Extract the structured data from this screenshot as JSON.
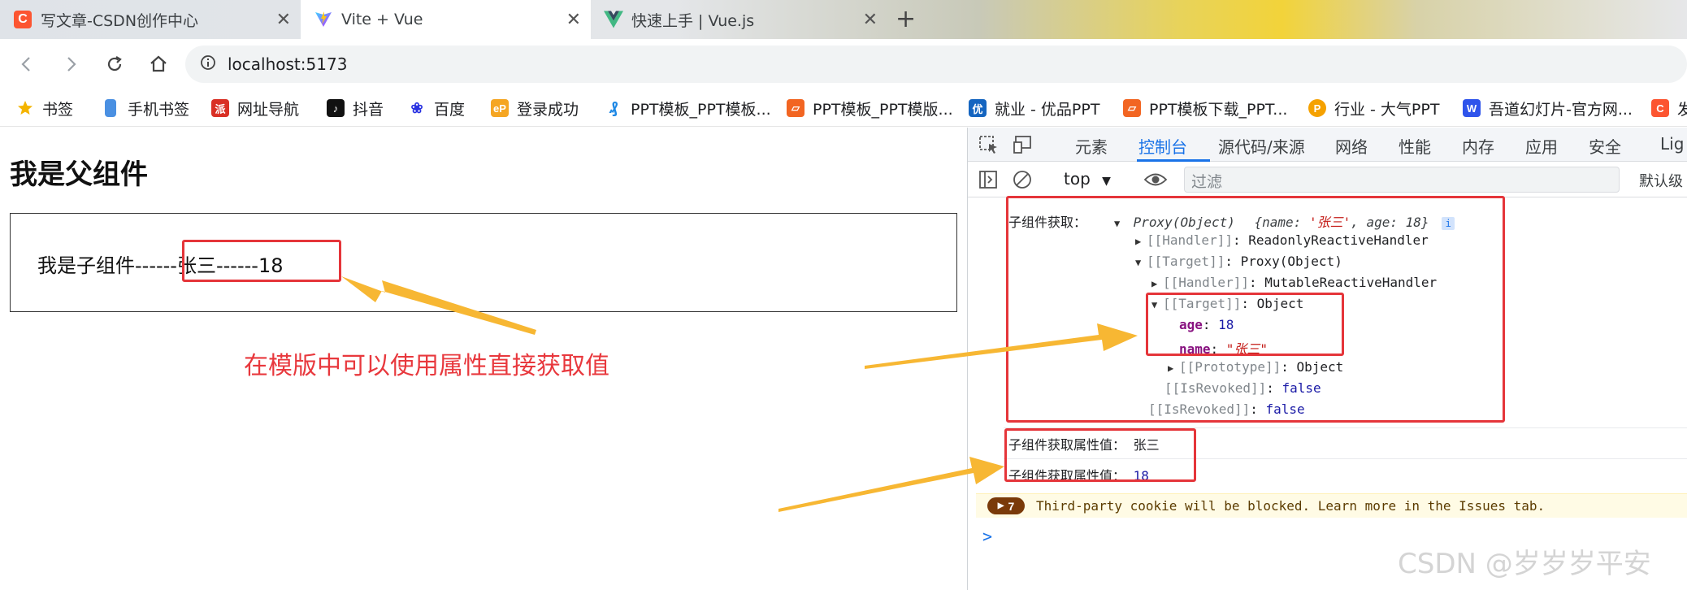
{
  "browser": {
    "tabs": [
      {
        "title": "写文章-CSDN创作中心",
        "favicon": "csdn-icon"
      },
      {
        "title": "Vite + Vue",
        "favicon": "vite-icon"
      },
      {
        "title": "快速上手 | Vue.js",
        "favicon": "vue-icon"
      }
    ],
    "new_tab_symbol": "+",
    "close_symbol": "✕",
    "url": "localhost:5173"
  },
  "bookmarks": [
    {
      "label": "书签",
      "icon": "star-icon",
      "color": "#f4b400"
    },
    {
      "label": "手机书签",
      "icon": "phone-icon",
      "color": "#4a90e2"
    },
    {
      "label": "网址导航",
      "icon": "nav-icon",
      "color": "#d93025"
    },
    {
      "label": "抖音",
      "icon": "douyin-icon",
      "color": "#111111"
    },
    {
      "label": "百度",
      "icon": "baidu-icon",
      "color": "#2932e1"
    },
    {
      "label": "登录成功",
      "icon": "ep-icon",
      "color": "#f5a623"
    },
    {
      "label": "PPT模板_PPT模板...",
      "icon": "ppt-icon",
      "color": "#1e88e5"
    },
    {
      "label": "PPT模板_PPT模版...",
      "icon": "ppt-orange-icon",
      "color": "#f26522"
    },
    {
      "label": "就业 - 优品PPT",
      "icon": "youpin-icon",
      "color": "#1565c0"
    },
    {
      "label": "PPT模板下载_PPT...",
      "icon": "ppt-orange2-icon",
      "color": "#f26522"
    },
    {
      "label": "行业 - 大气PPT",
      "icon": "daqi-icon",
      "color": "#f5a100"
    },
    {
      "label": "吾道幻灯片-官方网...",
      "icon": "wudao-icon",
      "color": "#2f54eb"
    },
    {
      "label": "发",
      "icon": "csdn-icon",
      "color": "#fc5531"
    }
  ],
  "page": {
    "parent_title": "我是父组件",
    "child_prefix": "我是子组件------",
    "child_name": "张三",
    "child_sep": "------",
    "child_age": "18",
    "annotation": "在模版中可以使用属性直接获取值"
  },
  "devtools": {
    "tabs": [
      "元素",
      "控制台",
      "源代码/来源",
      "网络",
      "性能",
      "内存",
      "应用",
      "安全",
      "Lig"
    ],
    "active_tab": "控制台",
    "context": "top",
    "filter_placeholder": "过滤",
    "level": "默认级",
    "console": {
      "log1_label": "子组件获取：",
      "proxy_head": "Proxy(Object)",
      "proxy_preview_open": "{name: ",
      "proxy_preview_name": "'张三'",
      "proxy_preview_age": ", age: 18}",
      "info_badge": "i",
      "handler1_key": "[[Handler]]",
      "handler1_val": ": ReadonlyReactiveHandler",
      "target1_key": "[[Target]]",
      "target1_val": ": Proxy(Object)",
      "handler2_key": "[[Handler]]",
      "handler2_val": ": MutableReactiveHandler",
      "target2_key": "[[Target]]",
      "target2_val": ": Object",
      "age_key": "age",
      "age_val": "18",
      "name_key": "name",
      "name_val": "\"张三\"",
      "proto_key": "[[Prototype]]",
      "proto_val": ": Object",
      "revoked1_key": "[[IsRevoked]]",
      "revoked1_val": "false",
      "revoked2_key": "[[IsRevoked]]",
      "revoked2_val": "false",
      "log2_label": "子组件获取属性值：",
      "log2_value": "张三",
      "log3_label": "子组件获取属性值：",
      "log3_value": "18",
      "warn_count": "7",
      "warn_text": "Third-party cookie will be blocked. Learn more in the Issues tab.",
      "prompt": ">"
    }
  },
  "watermark": "CSDN @岁岁岁平安",
  "colors": {
    "highlight": "#e5353a",
    "arrow": "#f7b733",
    "accent": "#1a73e8",
    "annotation": "#e8383d"
  }
}
